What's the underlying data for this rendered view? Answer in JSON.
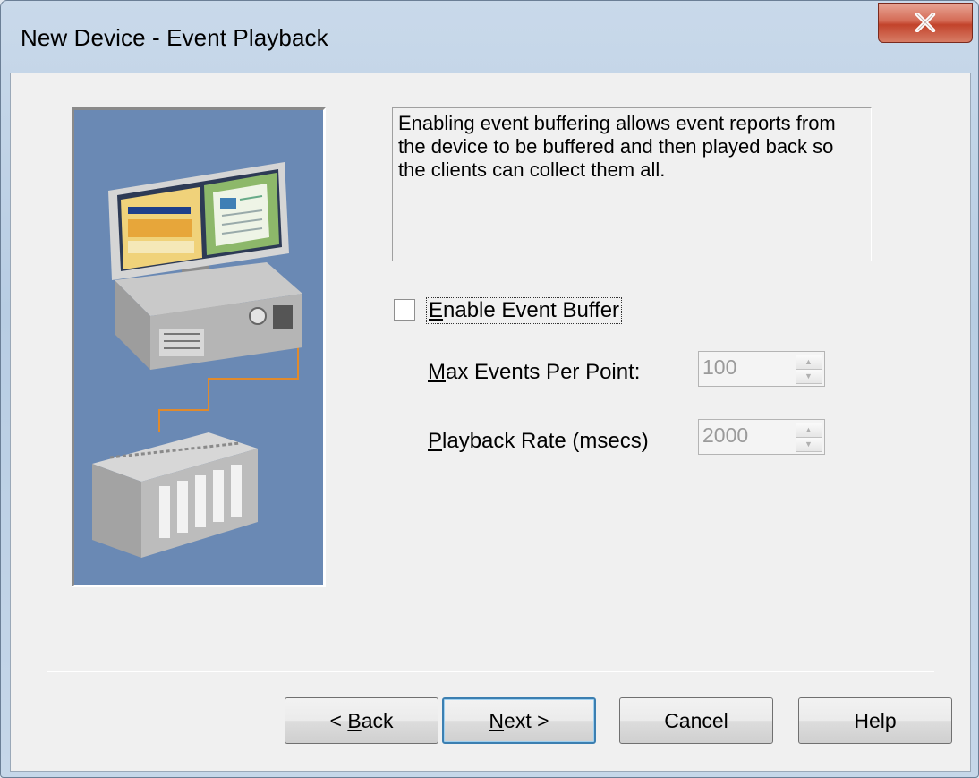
{
  "window": {
    "title": "New Device - Event Playback",
    "close_icon": "close-x-icon",
    "close_color": "#c9452f"
  },
  "illustration": {
    "icon": "computer-plc-illustration-icon",
    "background": "#6a89b4"
  },
  "description": "Enabling event buffering allows event reports from the device to be buffered and then played back so the clients can collect them all.",
  "enable_event_buffer": {
    "label_mnemonic": "E",
    "label_rest": "nable Event Buffer",
    "checked": false
  },
  "fields": [
    {
      "label_mnemonic": "M",
      "label_rest": "ax Events Per Point:",
      "value": "100",
      "enabled": false
    },
    {
      "label_mnemonic": "P",
      "label_rest": "layback Rate (msecs)",
      "value": "2000",
      "enabled": false
    }
  ],
  "buttons": {
    "back_prefix": "< ",
    "back_mnemonic": "B",
    "back_rest": "ack",
    "next_mnemonic": "N",
    "next_rest": "ext >",
    "cancel": "Cancel",
    "help": "Help"
  }
}
